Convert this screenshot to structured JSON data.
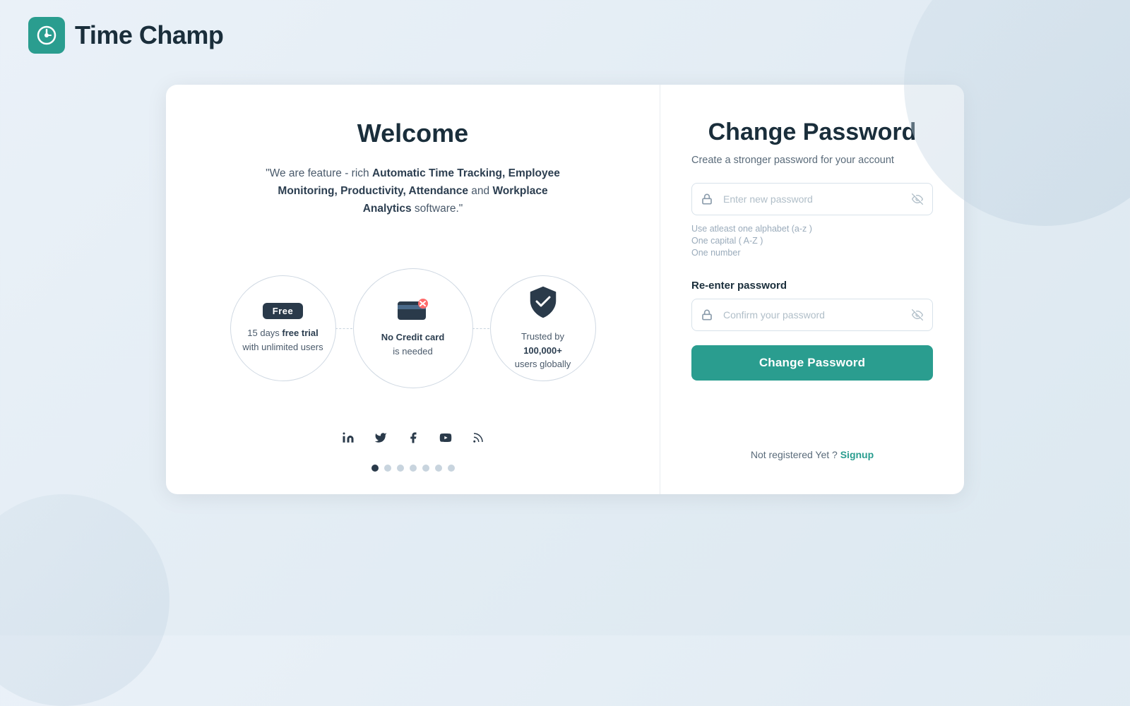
{
  "app": {
    "name": "Time Champ"
  },
  "header": {
    "logo_alt": "Time Champ logo"
  },
  "left": {
    "title": "Welcome",
    "description_prefix": "\"We are feature - rich ",
    "description_bold1": "Automatic Time Tracking, Employee Monitoring,",
    "description_middle": " ",
    "description_bold2": "Productivity, Attendance",
    "description_and": " and ",
    "description_bold3": "Workplace Analytics",
    "description_suffix": " software.\"",
    "features": [
      {
        "type": "badge",
        "badge_text": "Free",
        "label_line1": "15 days ",
        "label_bold": "free trial",
        "label_line2": "with unlimited users"
      },
      {
        "type": "icon_credit",
        "label_bold": "No Credit card",
        "label_line2": "is needed"
      },
      {
        "type": "icon_shield",
        "label_prefix": "Trusted by ",
        "label_bold": "100,000+",
        "label_line2": "users globally"
      }
    ],
    "social_icons": [
      "linkedin",
      "twitter",
      "facebook",
      "youtube",
      "rss"
    ],
    "dots_count": 7,
    "active_dot": 0
  },
  "right": {
    "title": "Change Password",
    "subtitle": "Create a stronger password for your account",
    "new_password_placeholder": "Enter new password",
    "hints": [
      "Use atleast one alphabet (a-z )",
      "One capital ( A-Z )",
      "One number"
    ],
    "reenter_label": "Re-enter password",
    "confirm_placeholder": "Confirm your password",
    "submit_label": "Change Password",
    "not_registered_text": "Not registered Yet ?",
    "signup_label": "Signup"
  }
}
